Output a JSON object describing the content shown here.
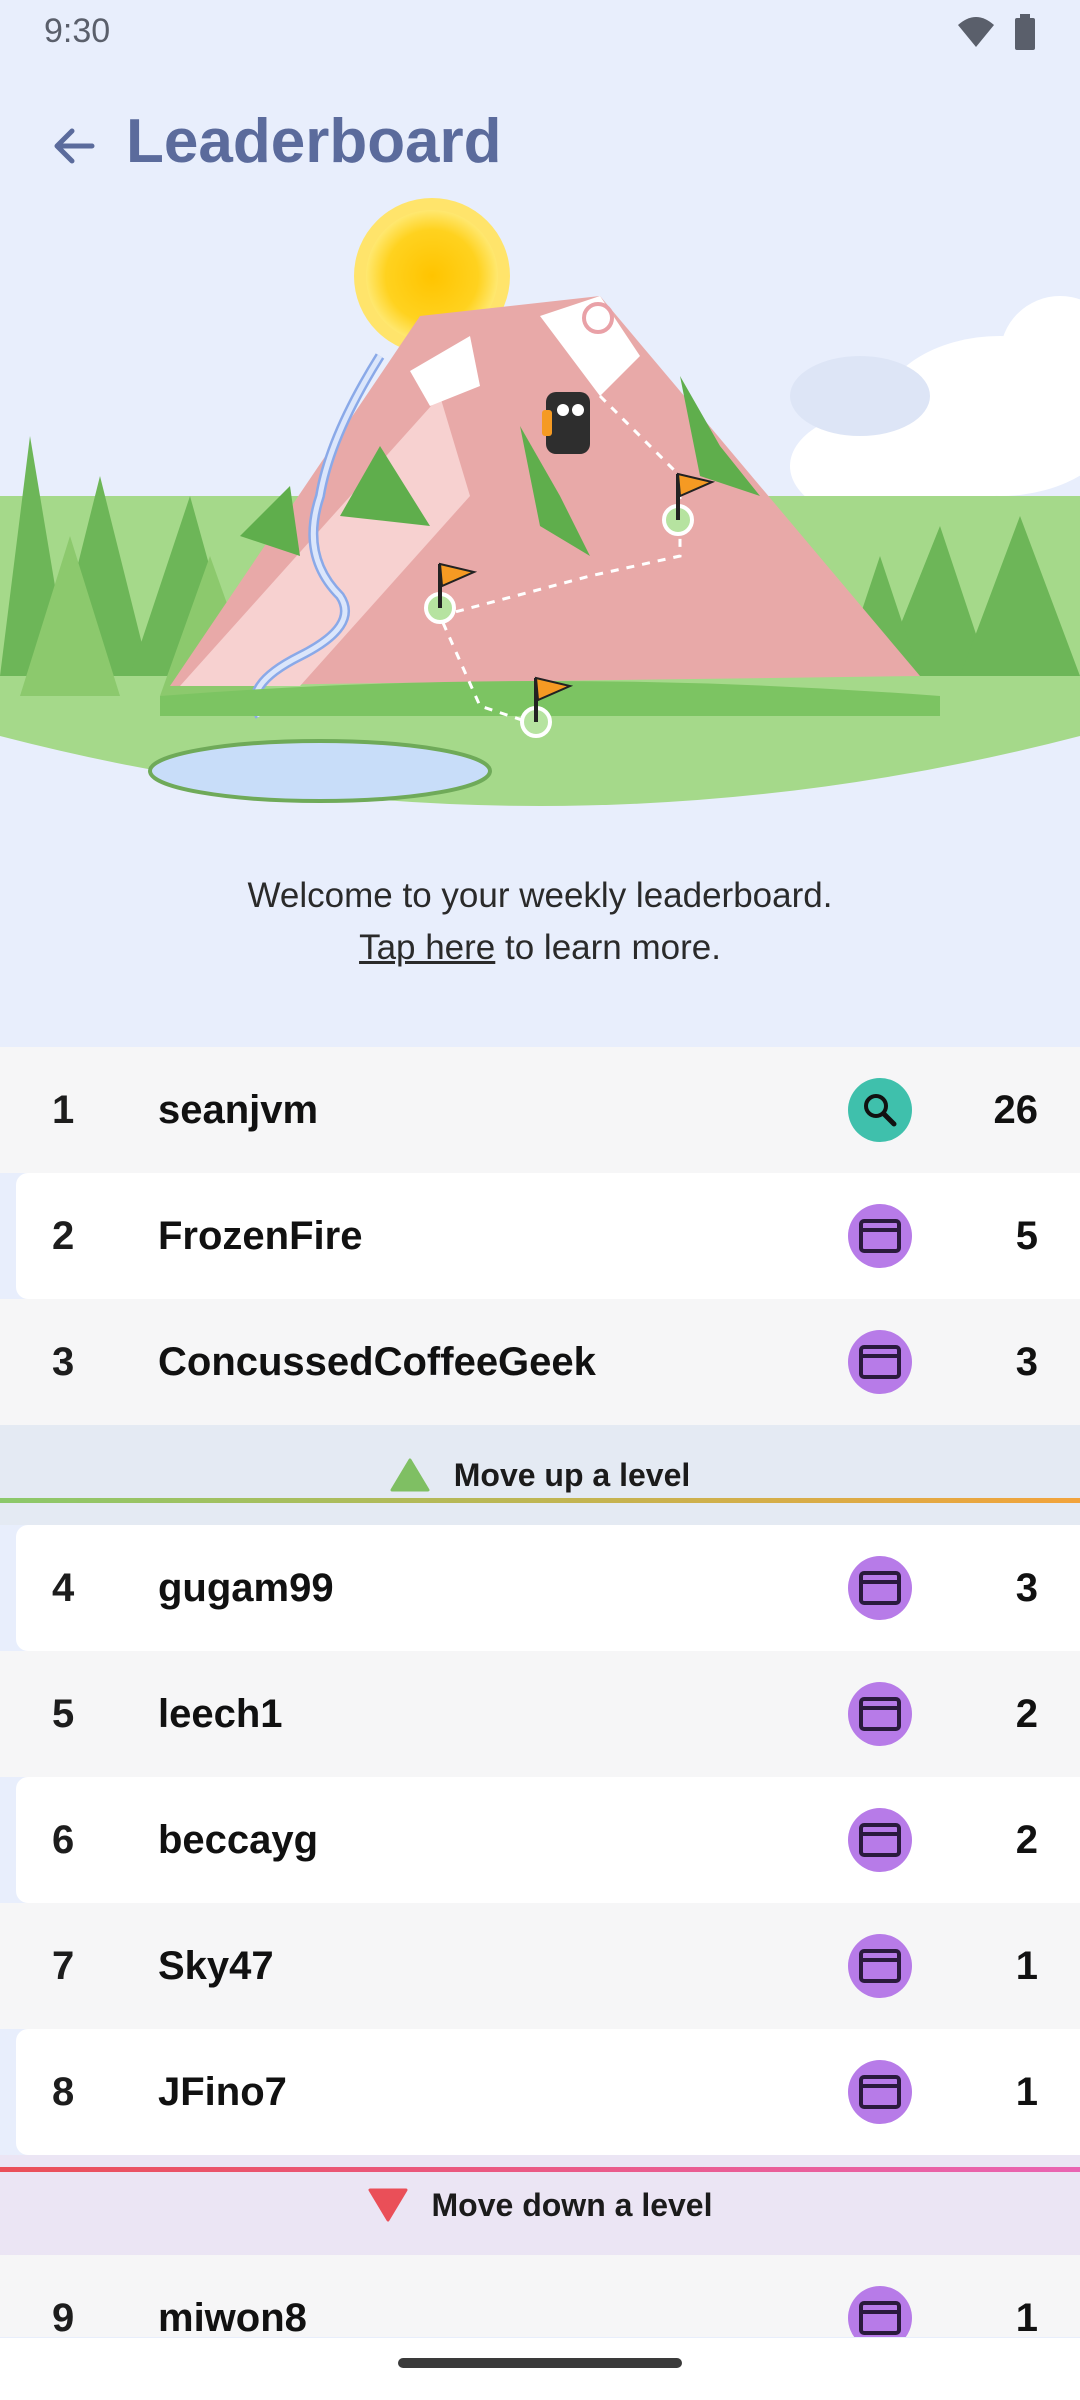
{
  "status": {
    "time": "9:30"
  },
  "header": {
    "title": "Leaderboard"
  },
  "welcome": {
    "line1": "Welcome to your weekly leaderboard.",
    "link": "Tap here",
    "line2_rest": " to learn more."
  },
  "leaderboard": {
    "top_rows": [
      {
        "rank": "1",
        "name": "seanjvm",
        "badge": "search-icon",
        "score": "26"
      },
      {
        "rank": "2",
        "name": "FrozenFire",
        "badge": "card-icon",
        "score": "5"
      },
      {
        "rank": "3",
        "name": "ConcussedCoffeeGeek",
        "badge": "card-icon",
        "score": "3"
      }
    ],
    "promotion_label": "Move up a level",
    "mid_rows": [
      {
        "rank": "4",
        "name": "gugam99",
        "badge": "card-icon",
        "score": "3"
      },
      {
        "rank": "5",
        "name": "leech1",
        "badge": "card-icon",
        "score": "2"
      },
      {
        "rank": "6",
        "name": "beccayg",
        "badge": "card-icon",
        "score": "2"
      },
      {
        "rank": "7",
        "name": "Sky47",
        "badge": "card-icon",
        "score": "1"
      },
      {
        "rank": "8",
        "name": "JFino7",
        "badge": "card-icon",
        "score": "1"
      }
    ],
    "demotion_label": "Move down a level",
    "bottom_rows": [
      {
        "rank": "9",
        "name": "miwon8",
        "badge": "card-icon",
        "score": "1"
      }
    ]
  },
  "colors": {
    "background": "#e8eefc",
    "title": "#5b6b9c",
    "search_badge": "#3fc0ac",
    "card_badge": "#b77be8",
    "promote": "#8bc86a",
    "demote": "#ea4f58"
  }
}
